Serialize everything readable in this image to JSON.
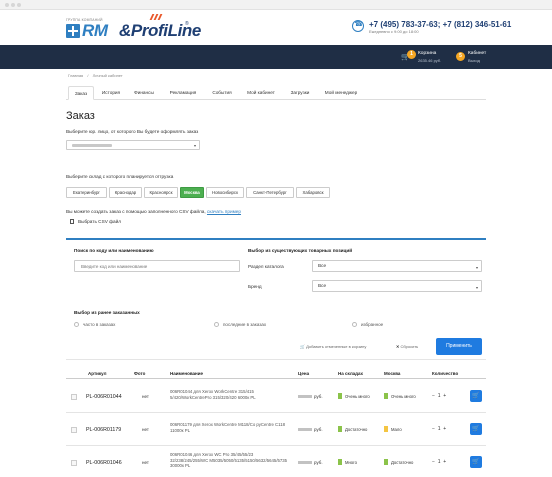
{
  "header": {
    "brand_small": "ГРУППА КОМПАНИЙ",
    "brand_rm": "RM",
    "brand_profi": "&ProfiLine",
    "brand_reg": "®",
    "phones": "+7 (495) 783-37-63; +7 (812) 346-51-61",
    "hours": "Ежедневно с 9:00 до 18:00"
  },
  "navbar": {
    "cart_count": "1",
    "cart_label": "Корзина",
    "cart_sum": "2635.46 руб.",
    "cabinet_count": "5",
    "cabinet_label": "Кабинет",
    "cabinet_sub": "Выход"
  },
  "breadcrumb": [
    "Главная",
    "Личный кабинет"
  ],
  "tabs": [
    {
      "label": "Заказ",
      "active": true
    },
    {
      "label": "История"
    },
    {
      "label": "Финансы"
    },
    {
      "label": "Рекламация"
    },
    {
      "label": "События"
    },
    {
      "label": "Мой кабинет"
    },
    {
      "label": "Загрузки"
    },
    {
      "label": "Мой менеджер"
    }
  ],
  "order": {
    "title": "Заказ",
    "jur_prompt": "Выберите юр. лицо, от которого Вы будете оформлять заказ",
    "warehouse_prompt": "Выберите склад с которого планируется отгрузка",
    "warehouses": [
      {
        "label": "Екатеринбург"
      },
      {
        "label": "Краснодар"
      },
      {
        "label": "Красноярск"
      },
      {
        "label": "Москва",
        "active": true
      },
      {
        "label": "Новосибирск"
      },
      {
        "label": "Санкт-Петербург"
      },
      {
        "label": "Хабаровск"
      }
    ],
    "csv_text": "Вы можете создать заказ с помощью заполненного CSV файла,",
    "csv_link": "скачать пример",
    "csv_choose": "Выбрать CSV файл"
  },
  "filter": {
    "search_label": "Поиск по коду или наименованию",
    "search_placeholder": "Введите код или наименование",
    "positions_label": "Выбор из существующих товарных позиций",
    "catalog_label": "Раздел каталога",
    "catalog_value": "Все",
    "brand_label": "Бренд",
    "brand_value": "Все",
    "ordered_label": "Выбор из ранее заказанных",
    "radio_often": "часто в заказах",
    "radio_last": "последние в заказах",
    "radio_fav": "избранное",
    "add_marked": "Добавить отмеченные в корзину",
    "reset": "Сбросить",
    "apply": "Применить"
  },
  "table": {
    "headers": [
      "Артикул",
      "Фото",
      "Наименование",
      "Цена",
      "На складах",
      "Москва",
      "Количество"
    ],
    "rows": [
      {
        "article": "PL-006R01044",
        "photo": "нет",
        "name": "006R01044 для Xerox WorkCentre 315/415 5/420/WorkCentrePro 315/320/420 6000к PL",
        "price_unit": "руб.",
        "stock": "Очень много",
        "stock_color": "#8bc34a",
        "moscow": "Очень много",
        "moscow_color": "#8bc34a",
        "qty": "1"
      },
      {
        "article": "PL-006R01179",
        "photo": "нет",
        "name": "006R01179 для Xerox WorkCentre M118/Co pyCentre C118 11000к PL",
        "price_unit": "руб.",
        "stock": "Достаточно",
        "stock_color": "#8bc34a",
        "moscow": "Мало",
        "moscow_color": "#f4c542",
        "qty": "1"
      },
      {
        "article": "PL-006R01046",
        "photo": "нет",
        "name": "006R01046 для Xerox WC Pro 35/45/55/23 32/238/245/255/WC M5035/5050/5135/5150/5632/5645/5735 30000к PL",
        "price_unit": "руб.",
        "stock": "Много",
        "stock_color": "#8bc34a",
        "moscow": "Достаточно",
        "moscow_color": "#8bc34a",
        "qty": "1"
      }
    ]
  }
}
